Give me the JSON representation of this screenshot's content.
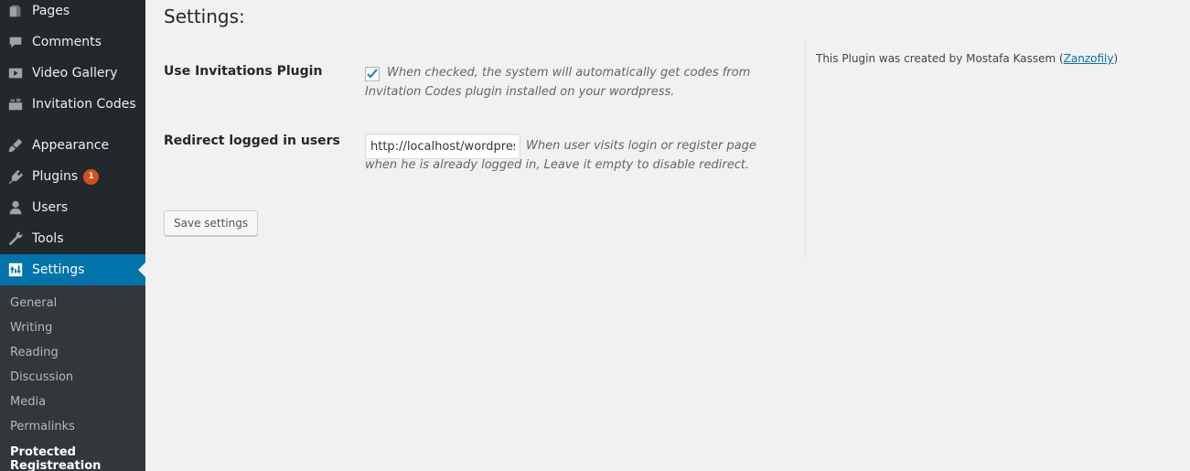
{
  "sidebar": {
    "items": [
      {
        "label": "Pages",
        "icon": "pages-icon"
      },
      {
        "label": "Comments",
        "icon": "comments-icon"
      },
      {
        "label": "Video Gallery",
        "icon": "video-icon"
      },
      {
        "label": "Invitation Codes",
        "icon": "invitation-icon"
      },
      {
        "label": "Appearance",
        "icon": "appearance-icon"
      },
      {
        "label": "Plugins",
        "icon": "plugins-icon",
        "badge": "1"
      },
      {
        "label": "Users",
        "icon": "users-icon"
      },
      {
        "label": "Tools",
        "icon": "tools-icon"
      },
      {
        "label": "Settings",
        "icon": "settings-icon",
        "active": true
      }
    ],
    "submenu": [
      {
        "label": "General"
      },
      {
        "label": "Writing"
      },
      {
        "label": "Reading"
      },
      {
        "label": "Discussion"
      },
      {
        "label": "Media"
      },
      {
        "label": "Permalinks"
      },
      {
        "label": "Protected Registreation",
        "current": true
      }
    ]
  },
  "main": {
    "title": "Settings:",
    "use_invitations": {
      "label": "Use Invitations Plugin",
      "checked": true,
      "description": "When checked, the system will automatically get codes from Invitation Codes plugin installed on your wordpress."
    },
    "redirect": {
      "label": "Redirect logged in users",
      "value": "http://localhost/wordpress",
      "description": "When user visits login or register page when he is already logged in, Leave it empty to disable redirect."
    },
    "save_label": "Save settings"
  },
  "credit": {
    "prefix": "This Plugin was created by Mostafa Kassem (",
    "link_text": "Zanzofily",
    "suffix": ")"
  },
  "colors": {
    "sidebar_bg": "#23282d",
    "submenu_bg": "#32373c",
    "active_bg": "#0073aa",
    "badge": "#d54e21",
    "link": "#0073aa"
  }
}
